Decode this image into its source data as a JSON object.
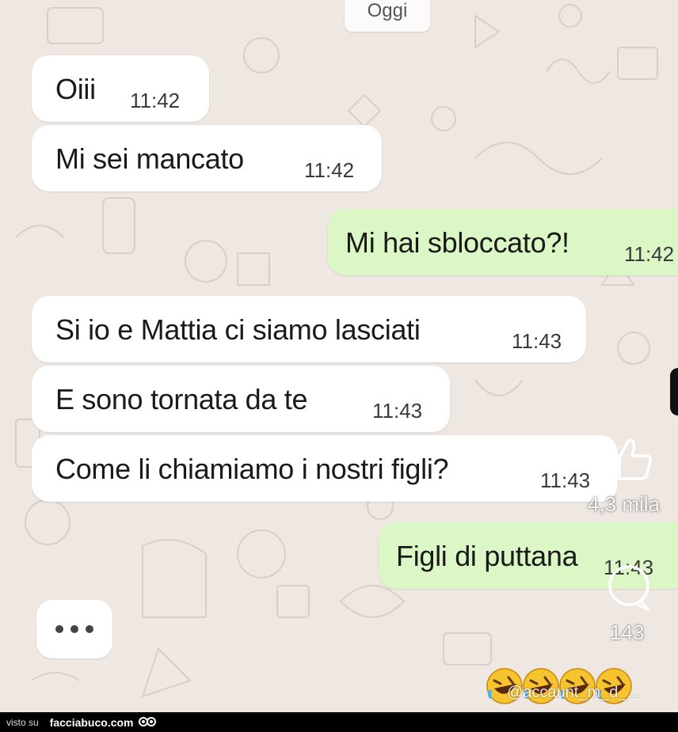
{
  "chat": {
    "date_label": "Oggi",
    "messages": [
      {
        "dir": "in",
        "text": "Oiii",
        "time": "11:42"
      },
      {
        "dir": "in",
        "text": "Mi sei mancato",
        "time": "11:42"
      },
      {
        "dir": "out",
        "text": "Mi hai sbloccato?!",
        "time": "11:42"
      },
      {
        "dir": "in",
        "text": "Si io e Mattia ci siamo lasciati",
        "time": "11:43"
      },
      {
        "dir": "in",
        "text": "E sono tornata da te",
        "time": "11:43"
      },
      {
        "dir": "in",
        "text": "Come li chiamiamo i nostri figli?",
        "time": "11:43"
      },
      {
        "dir": "out",
        "text": "Figli di puttana",
        "time": "11:43"
      }
    ],
    "typing_indicator": "•••"
  },
  "overlay": {
    "like_icon": "thumbs-up-icon",
    "like_count": "4,3 mila",
    "comment_icon": "comment-bubble-icon",
    "comment_count": "143",
    "reactions": [
      "rolling-laughing-emoji",
      "rolling-laughing-emoji",
      "rolling-laughing-emoji",
      "rolling-laughing-emoji"
    ],
    "handle": "@accaunt_m_d_..."
  },
  "footer": {
    "seen_on": "visto su",
    "site": "facciabuco.com"
  },
  "colors": {
    "background": "#efe7e2",
    "incoming_bubble": "#ffffff",
    "outgoing_bubble": "#dcf7c6"
  }
}
